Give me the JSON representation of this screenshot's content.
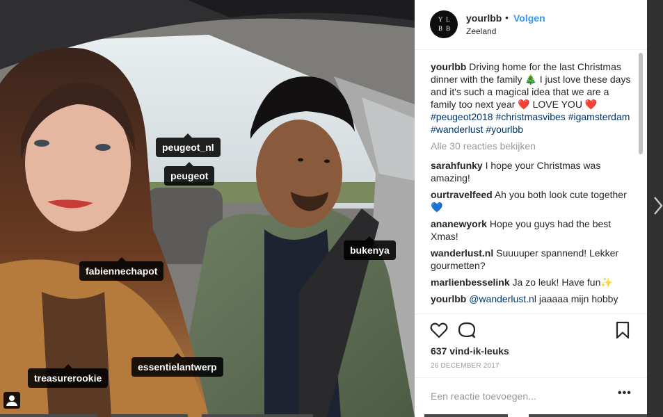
{
  "post": {
    "username": "yourlbb",
    "follow_label": "Volgen",
    "dot": "•",
    "location": "Zeeland",
    "avatar_letters": [
      "Y",
      "L",
      "B",
      "B"
    ]
  },
  "caption": {
    "username": "yourlbb",
    "text": "Driving home for the last Christmas dinner with the family 🎄 I just love these days and it's such a magical idea that we are a family too next year ❤️ LOVE YOU ❤️",
    "hashtags": [
      "#peugeot2018",
      "#christmasvibes",
      "#igamsterdam",
      "#wanderlust",
      "#yourlbb"
    ]
  },
  "view_all_label": "Alle 30 reacties bekijken",
  "comments": [
    {
      "user": "sarahfunky",
      "text": "I hope your Christmas was amazing!"
    },
    {
      "user": "ourtravelfeed",
      "text": "Ah you both look cute together 💙"
    },
    {
      "user": "ananewyork",
      "text": "Hope you guys had the best Xmas!"
    },
    {
      "user": "wanderlust.nl",
      "text": "Suuuuper spannend! Lekker gourmetten?"
    },
    {
      "user": "marlienbesselink",
      "text": "Ja zo leuk! Have fun✨"
    },
    {
      "user": "yourlbb",
      "mention": "@wanderlust.nl",
      "text": "jaaaaa mijn hobby"
    }
  ],
  "likes_label": "637 vind-ik-leuks",
  "date_label": "26 DECEMBER 2017",
  "comment_input": {
    "placeholder": "Een reactie toevoegen...",
    "value": ""
  },
  "more_label": "•••",
  "photo_tags": [
    {
      "id": "peugeot_nl",
      "label": "peugeot_nl"
    },
    {
      "id": "peugeot",
      "label": "peugeot"
    },
    {
      "id": "fabiennechapot",
      "label": "fabiennechapot"
    },
    {
      "id": "bukenya",
      "label": "bukenya"
    },
    {
      "id": "treasurerookie",
      "label": "treasurerookie"
    },
    {
      "id": "essentielantwerp",
      "label": "essentielantwerp"
    }
  ],
  "icons": [
    "heart-icon",
    "comment-icon",
    "bookmark-icon",
    "user-tag-icon",
    "chevron-right-icon"
  ],
  "colors": {
    "link": "#3897f0",
    "hashtag": "#003569",
    "heart": "#ed4956",
    "muted": "#999999"
  }
}
